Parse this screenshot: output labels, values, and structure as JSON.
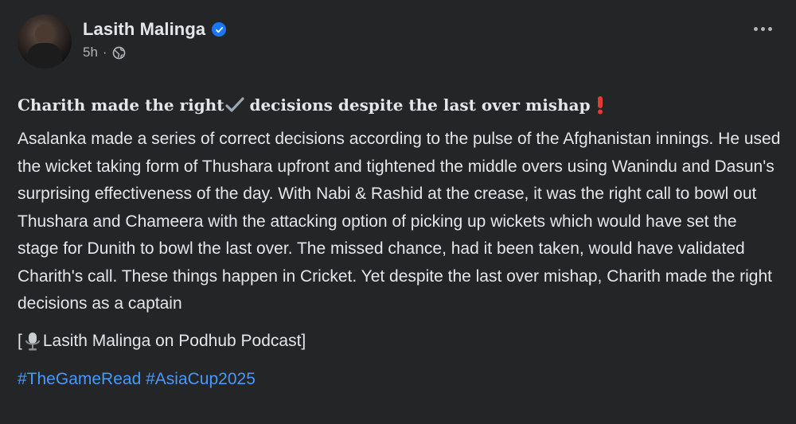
{
  "post": {
    "author": "Lasith Malinga",
    "time": "5h",
    "separator": "·",
    "headline_part1": "Charith made the right",
    "headline_part2": "decisions despite the last over mishap",
    "body": "Asalanka made a series of correct decisions according to the pulse of the Afghanistan innings. He used the wicket taking form of Thushara upfront and tightened the middle overs using Wanindu and Dasun's surprising effectiveness of the day. With Nabi & Rashid at the crease, it was the right call to bowl out Thushara and Chameera with the attacking option of picking up wickets which would have set the stage for Dunith to bowl the last over. The missed chance, had it been taken, would have validated Charith's call. These things happen in Cricket. Yet despite the last over mishap, Charith made the right decisions as a captain",
    "credit_open": "[",
    "credit_text": "Lasith Malinga on Podhub Podcast]",
    "hashtags": [
      "#TheGameRead",
      "#AsiaCup2025"
    ]
  },
  "colors": {
    "background": "#242526",
    "text": "#e4e6eb",
    "secondary": "#b0b3b8",
    "link": "#4599ff",
    "verified": "#1877f2",
    "exclamation": "#e53935"
  },
  "icons": {
    "verified": "verified-badge-icon",
    "audience": "globe-icon",
    "more": "more-options-icon",
    "check": "check-mark-icon",
    "exclamation": "exclamation-icon",
    "mic": "microphone-icon"
  }
}
